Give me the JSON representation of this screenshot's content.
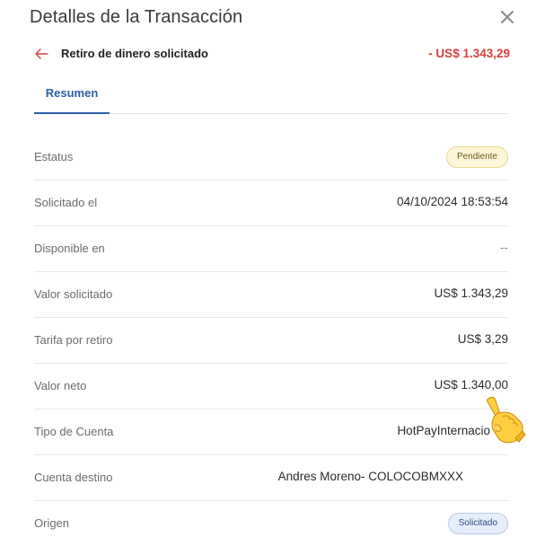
{
  "dialog": {
    "title": "Detalles de la Transacción",
    "close_icon": "close-icon"
  },
  "transaction": {
    "back_icon": "arrow-left-icon",
    "name": "Retiro de dinero solicitado",
    "amount": "- US$ 1.343,29",
    "amount_color": "#d9403a"
  },
  "tabs": [
    {
      "label": "Resumen",
      "active": true
    }
  ],
  "details": {
    "status": {
      "label": "Estatus",
      "value": "Pendiente"
    },
    "requested_at": {
      "label": "Solicitado el",
      "value": "04/10/2024 18:53:54"
    },
    "available_at": {
      "label": "Disponible en",
      "value": "--"
    },
    "requested_amount": {
      "label": "Valor solicitado",
      "value": "US$ 1.343,29"
    },
    "fee": {
      "label": "Tarifa por retiro",
      "value": "US$ 3,29"
    },
    "net_amount": {
      "label": "Valor neto",
      "value": "US$ 1.340,00"
    },
    "account_type": {
      "label": "Tipo de Cuenta",
      "value": "HotPayInternacio"
    },
    "destination": {
      "label": "Cuenta destino",
      "value": "Andres Moreno- COLOCOBMXXX"
    },
    "origin": {
      "label": "Origen",
      "value": "Solicitado"
    }
  },
  "overlay": {
    "icon": "pointing-hand-icon"
  },
  "colors": {
    "accent": "#2b5fa8",
    "negative": "#d9403a"
  }
}
